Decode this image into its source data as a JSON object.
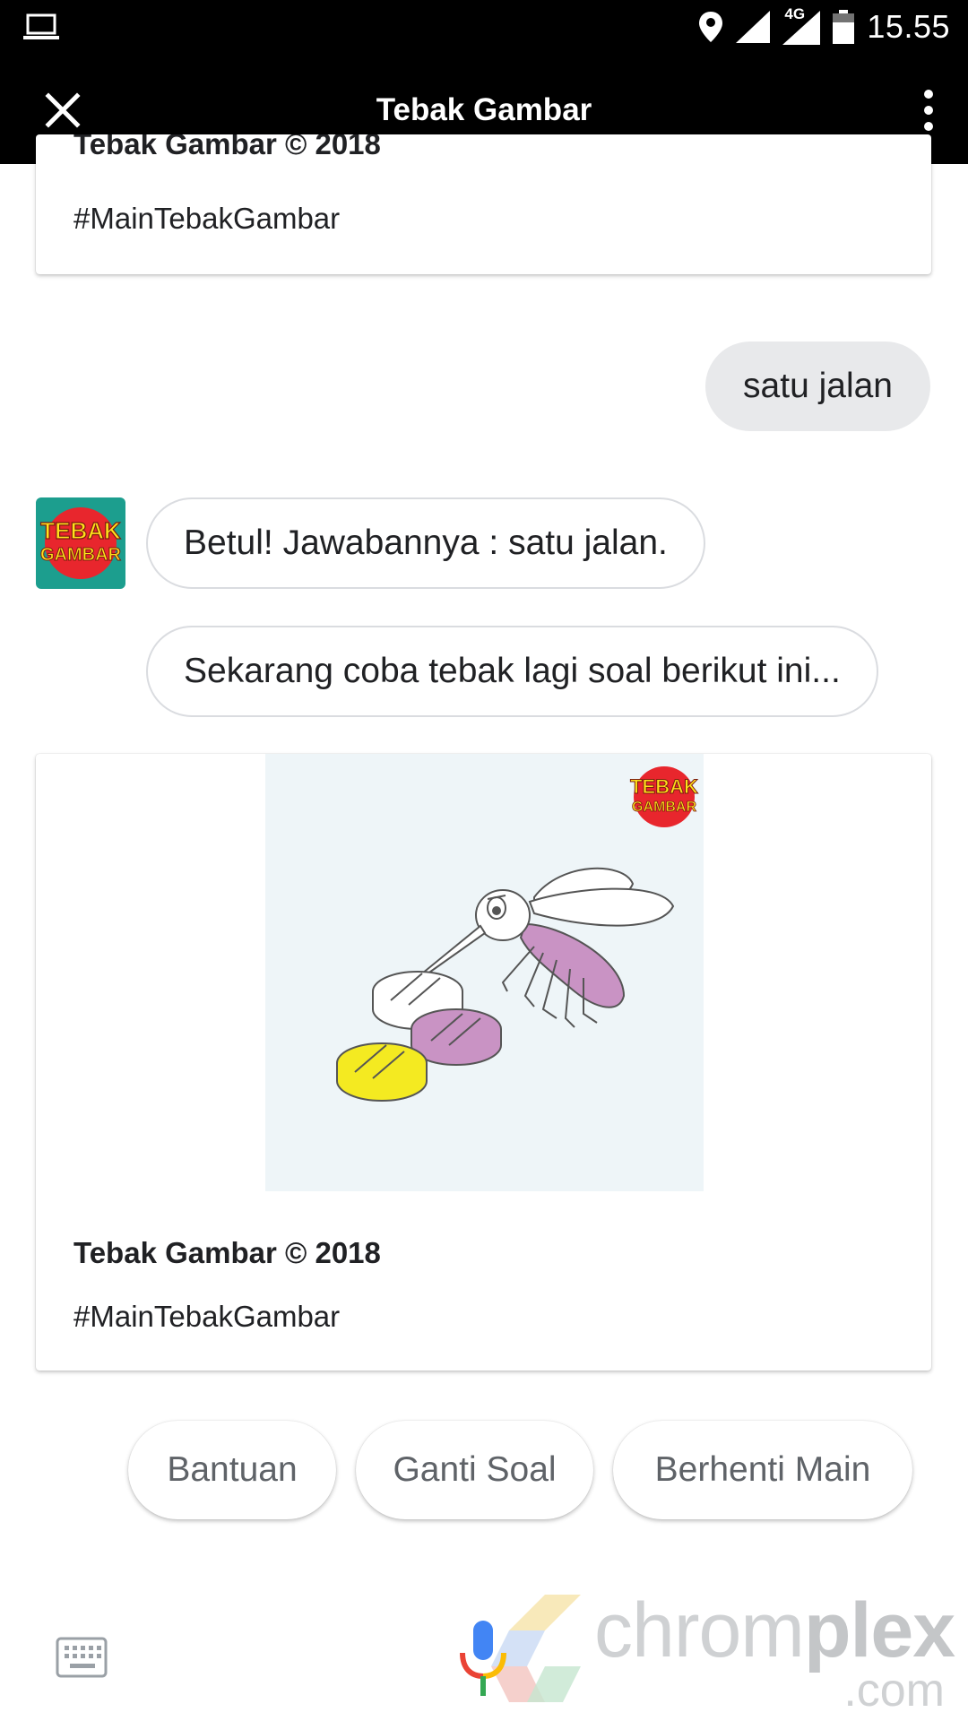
{
  "status_bar": {
    "network": "4G",
    "time": "15.55"
  },
  "app_bar": {
    "title": "Tebak Gambar"
  },
  "conversation": {
    "previous_card": {
      "title": "Tebak Gambar © 2018",
      "hashtag": "#MainTebakGambar"
    },
    "user_message": "satu jalan",
    "bot_avatar": {
      "line1": "TEBAK",
      "line2": "GAMBAR"
    },
    "bot_messages": [
      "Betul! Jawabannya : satu jalan.",
      "Sekarang coba tebak lagi soal berikut ini..."
    ],
    "quiz_card": {
      "image_logo_line1": "TEBAK",
      "image_logo_line2": "GAMBAR",
      "title": "Tebak Gambar © 2018",
      "hashtag": "#MainTebakGambar"
    }
  },
  "suggestion_chips": [
    "Bantuan",
    "Ganti Soal",
    "Berhenti Main"
  ],
  "watermark": {
    "brand_light": "chrom",
    "brand_bold": "plex",
    "domain": ".com"
  },
  "colors": {
    "bar_background": "#000000",
    "bubble_user": "#e8e9eb",
    "avatar_background": "#1c9e8e",
    "image_background": "#eef5f8",
    "mosquito_body": "#c993c4",
    "pill_yellow": "#f4ea21",
    "pill_purple": "#c993c4"
  },
  "icons": {
    "status_left": "laptop-icon",
    "status_right": [
      "location-icon",
      "signal-icon",
      "signal-4g-icon",
      "battery-icon"
    ],
    "app_bar_left": "close-icon",
    "app_bar_right": "more-vert-icon",
    "bottom_left": "keyboard-icon",
    "bottom_center": "mic-icon"
  }
}
